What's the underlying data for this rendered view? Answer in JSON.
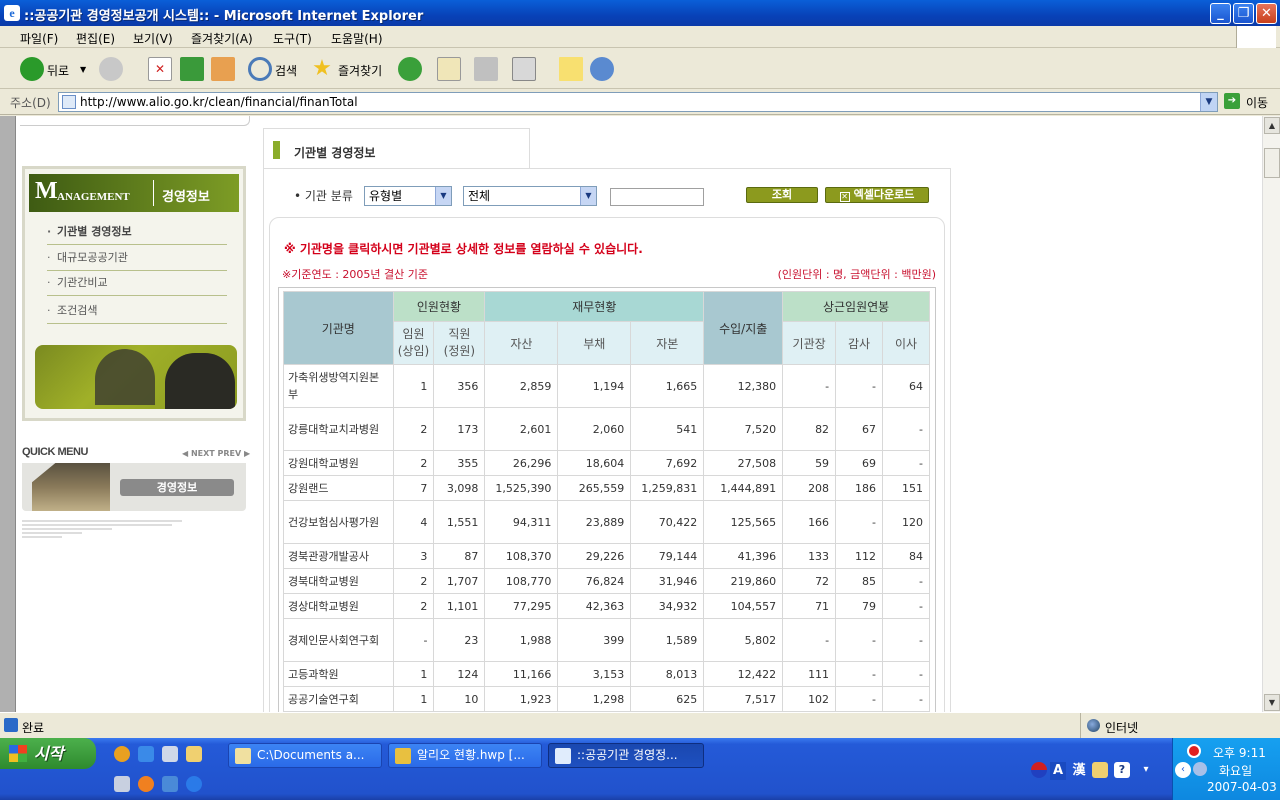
{
  "window": {
    "title": "::공공기관 경영정보공개 시스템:: - Microsoft Internet Explorer"
  },
  "menu": [
    "파일(F)",
    "편집(E)",
    "보기(V)",
    "즐겨찾기(A)",
    "도구(T)",
    "도움말(H)"
  ],
  "toolbar": {
    "back": "뒤로",
    "search": "검색",
    "favorites": "즐겨찾기"
  },
  "address": {
    "label": "주소(D)",
    "url": "http://www.alio.go.kr/clean/financial/finanTotal",
    "go": "이동"
  },
  "sidebar": {
    "brand_initial": "M",
    "brand_rest": "ANAGEMENT",
    "brand_ko": "경영정보",
    "items": [
      "기관별 경영정보",
      "대규모공공기관",
      "기관간비교",
      "조건검색"
    ],
    "quick_menu": "QUICK MENU",
    "quick_nav": "◀ NEXT  PREV ▶",
    "quick_button": "경영정보"
  },
  "main": {
    "tab_title": "기관별 경영정보",
    "filter_label": "• 기관 분류",
    "filter_type": "유형별",
    "filter_all": "전체",
    "search_button": "조회",
    "excel_button": "엑셀다운로드",
    "notice": "※ 기관명을 클릭하시면 기관별로 상세한 정보를 열람하실 수 있습니다.",
    "base_year": "※기준연도 : 2005년 결산 기준",
    "unit": "(인원단위 : 명, 금액단위 : 백만원)"
  },
  "table": {
    "headers": {
      "name": "기관명",
      "staff": "인원현황",
      "finance": "재무현황",
      "income": "수입/지출",
      "exec_pay": "상근임원연봉",
      "exec": "임원\n(상임)",
      "employee": "직원\n(정원)",
      "assets": "자산",
      "debt": "부채",
      "capital": "자본",
      "head": "기관장",
      "auditor": "감사",
      "director": "이사"
    },
    "rows": [
      {
        "name": "가축위생방역지원본부",
        "tall": true,
        "cells": [
          "1",
          "356",
          "2,859",
          "1,194",
          "1,665",
          "12,380",
          "-",
          "-",
          "64"
        ]
      },
      {
        "name": "강릉대학교치과병원",
        "tall": true,
        "cells": [
          "2",
          "173",
          "2,601",
          "2,060",
          "541",
          "7,520",
          "82",
          "67",
          "-"
        ]
      },
      {
        "name": "강원대학교병원",
        "tall": false,
        "cells": [
          "2",
          "355",
          "26,296",
          "18,604",
          "7,692",
          "27,508",
          "59",
          "69",
          "-"
        ]
      },
      {
        "name": "강원랜드",
        "tall": false,
        "cells": [
          "7",
          "3,098",
          "1,525,390",
          "265,559",
          "1,259,831",
          "1,444,891",
          "208",
          "186",
          "151"
        ]
      },
      {
        "name": "건강보험심사평가원",
        "tall": true,
        "cells": [
          "4",
          "1,551",
          "94,311",
          "23,889",
          "70,422",
          "125,565",
          "166",
          "-",
          "120"
        ]
      },
      {
        "name": "경북관광개발공사",
        "tall": false,
        "cells": [
          "3",
          "87",
          "108,370",
          "29,226",
          "79,144",
          "41,396",
          "133",
          "112",
          "84"
        ]
      },
      {
        "name": "경북대학교병원",
        "tall": false,
        "cells": [
          "2",
          "1,707",
          "108,770",
          "76,824",
          "31,946",
          "219,860",
          "72",
          "85",
          "-"
        ]
      },
      {
        "name": "경상대학교병원",
        "tall": false,
        "cells": [
          "2",
          "1,101",
          "77,295",
          "42,363",
          "34,932",
          "104,557",
          "71",
          "79",
          "-"
        ]
      },
      {
        "name": "경제인문사회연구회",
        "tall": true,
        "cells": [
          "-",
          "23",
          "1,988",
          "399",
          "1,589",
          "5,802",
          "-",
          "-",
          "-"
        ]
      },
      {
        "name": "고등과학원",
        "tall": false,
        "cells": [
          "1",
          "124",
          "11,166",
          "3,153",
          "8,013",
          "12,422",
          "111",
          "-",
          "-"
        ]
      },
      {
        "name": "공공기술연구회",
        "tall": false,
        "cells": [
          "1",
          "10",
          "1,923",
          "1,298",
          "625",
          "7,517",
          "102",
          "-",
          "-"
        ]
      }
    ]
  },
  "status": {
    "text": "완료",
    "zone": "인터넷"
  },
  "taskbar": {
    "start": "시작",
    "tasks": [
      "C:\\Documents a...",
      "알리오 현황.hwp [...",
      "::공공기관 경영정..."
    ],
    "ime": [
      "A",
      "漢"
    ],
    "clock_time": "오후 9:11",
    "clock_day": "화요일",
    "clock_date": "2007-04-03"
  }
}
